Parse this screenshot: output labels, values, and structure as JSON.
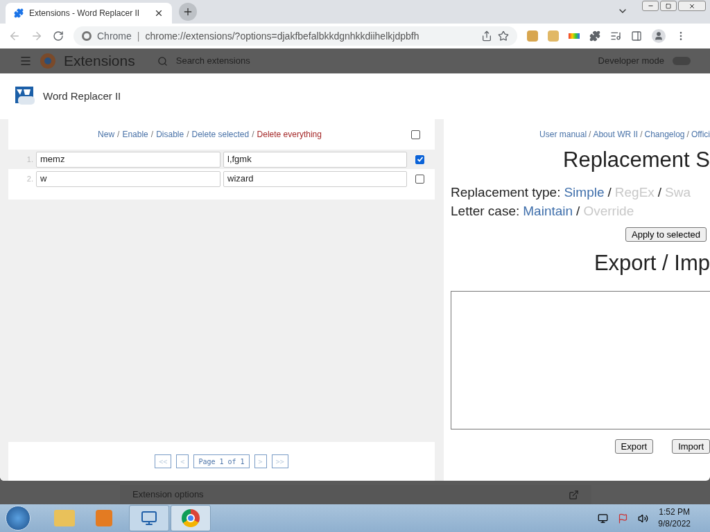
{
  "browser": {
    "tab_title": "Extensions - Word Replacer II",
    "site_label": "Chrome",
    "divider": "|",
    "url": "chrome://extensions/?options=djakfbefalbkkdgnhkkdiihelkjdpbfh"
  },
  "page_behind": {
    "title": "Extensions",
    "search_placeholder": "Search extensions",
    "developer_mode": {
      "label": "Developer mode",
      "on": false
    },
    "footer_item": "Extension options"
  },
  "dialog": {
    "title": "Word Replacer II",
    "actions": [
      {
        "label": "New",
        "kind": "link"
      },
      {
        "separator": "/",
        "label": "Enable",
        "kind": "link"
      },
      {
        "separator": "/",
        "label": "Disable",
        "kind": "link"
      },
      {
        "separator": "/",
        "label": "Delete selected",
        "kind": "link"
      },
      {
        "separator": "/",
        "label": "Delete everything",
        "kind": "danger"
      }
    ],
    "select_all": {
      "checked": false
    },
    "rules": [
      {
        "number": "1.",
        "find": "memz",
        "replace": "l,fgmk",
        "checked": true
      },
      {
        "number": "2.",
        "find": "w",
        "replace": "wizard",
        "checked": false
      }
    ],
    "pagination": {
      "first": "<<",
      "prev": "<",
      "label": "Page 1 of 1",
      "next": ">",
      "last": ">>"
    },
    "links": [
      {
        "label": "User manual"
      },
      {
        "separator": "/",
        "label": "About WR II"
      },
      {
        "separator": "/",
        "label": "Changelog"
      },
      {
        "separator": "/",
        "label": "Offici"
      }
    ],
    "heading": "Replacement S",
    "settings": [
      {
        "label": "Replacement type:",
        "options": [
          {
            "label": "Simple",
            "selected": true
          },
          {
            "separator": "/",
            "label": "RegEx",
            "selected": false
          },
          {
            "separator": "/",
            "label": "Swa",
            "selected": false
          }
        ]
      },
      {
        "label": "Letter case:",
        "options": [
          {
            "label": "Maintain",
            "selected": true
          },
          {
            "separator": "/",
            "label": "Override",
            "selected": false
          }
        ]
      }
    ],
    "apply_button": "Apply to selected",
    "export_heading": "Export / Imp",
    "buttons": [
      "Export",
      "Import"
    ]
  },
  "taskbar": {
    "time": "1:52 PM",
    "date": "9/8/2022"
  }
}
